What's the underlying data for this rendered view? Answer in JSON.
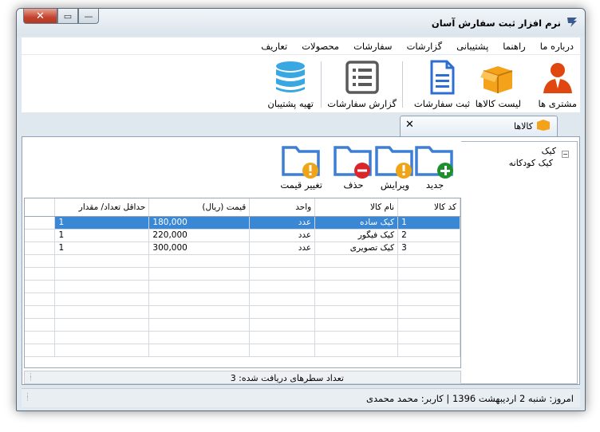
{
  "window": {
    "title": "نرم افزار ثبت سفارش آسان",
    "close_glyph": "✕",
    "max_glyph": "▭",
    "min_glyph": "—"
  },
  "menu": [
    "تعاریف",
    "محصولات",
    "سفارشات",
    "گزارشات",
    "پشتیبانی",
    "راهنما",
    "درباره ما"
  ],
  "ribbon": {
    "customers": "مشتری ها",
    "products": "لیست کالاها",
    "orders": "ثبت سفارشات",
    "report": "گزارش سفارشات",
    "backup": "تهیه پشتیبان"
  },
  "tab": {
    "label": "کالاها",
    "close": "✕"
  },
  "tree": {
    "root": "کیک",
    "child": "کیک کودکانه",
    "expander": "−"
  },
  "toolbar": {
    "new": "جدید",
    "edit": "ویرایش",
    "delete": "حذف",
    "price": "تغییر قیمت"
  },
  "grid": {
    "headers": [
      "کد کالا",
      "نام کالا",
      "واحد",
      "قیمت (ریال)",
      "حداقل تعداد/ مقدار"
    ],
    "rows": [
      [
        "1",
        "کیک ساده",
        "عدد",
        "180,000",
        "1"
      ],
      [
        "2",
        "کیک فیگور",
        "عدد",
        "220,000",
        "1"
      ],
      [
        "3",
        "کیک تصویری",
        "عدد",
        "300,000",
        "1"
      ]
    ]
  },
  "footer": {
    "text": "تعداد سطرهای دریافت شده:  3"
  },
  "status": {
    "text": "امروز: شنبه 2 اردیبهشت 1396  |  کاربر: محمد محمدی"
  },
  "colors": {
    "accent": "#3a87d6",
    "person": "#e0460f",
    "box": "#f4a21a",
    "doc": "#2c6fd1",
    "folder": "#3e7fd6",
    "db": "#39a7e1"
  }
}
